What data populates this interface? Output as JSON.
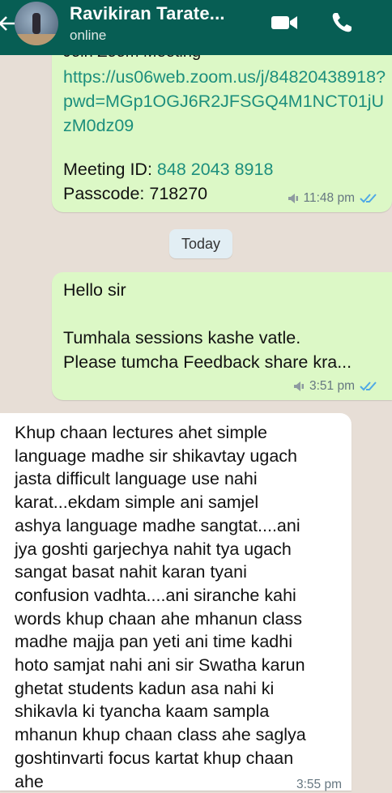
{
  "header": {
    "contact_name": "Ravikiran Tarate...",
    "status": "online",
    "icons": [
      "back-arrow-icon",
      "video-call-icon",
      "voice-call-icon"
    ]
  },
  "messages": [
    {
      "direction": "outgoing",
      "partial_top": "Join Zoom Meeting",
      "link": "https://us06web.zoom.us/j/84820438918?pwd=MGp1OGJ6R2JFSGQ4M1NCT01jUzM0dz09",
      "meeting_id_label": "Meeting ID: ",
      "meeting_id": "848 2043 8918",
      "passcode": "Passcode: 718270",
      "time": "11:48 pm"
    },
    {
      "direction": "outgoing",
      "line1": "Hello sir",
      "line2": "Tumhala sessions kashe vatle.\nPlease tumcha Feedback share kra...",
      "time": "3:51 pm"
    },
    {
      "direction": "incoming",
      "text": "Khup chaan lectures ahet simple\nlanguage madhe sir shikavtay ugach\njasta difficult language use nahi\nkarat...ekdam simple ani samjel\nashya language madhe sangtat....ani\njya goshti garjechya nahit tya ugach\nsangat basat nahit karan tyani\nconfusion vadhta....ani siranche kahi\nwords khup chaan ahe mhanun class\nmadhe majja pan yeti ani time kadhi\nhoto samjat nahi ani sir Swatha karun\nghetat students kadun asa nahi ki\nshikavla ki tyancha kaam sampla\nmhanun khup chaan class ahe saglya\ngoshtinvarti focus kartat khup chaan\nahe",
      "time": "3:55 pm"
    }
  ],
  "date_separator": "Today",
  "colors": {
    "header": "#075e54",
    "chat_background": "#e7ded6",
    "outgoing_bubble": "#dcf8c6",
    "incoming_bubble": "#ffffff",
    "link": "#1d8f7d",
    "read_ticks": "#4fa8e6"
  }
}
